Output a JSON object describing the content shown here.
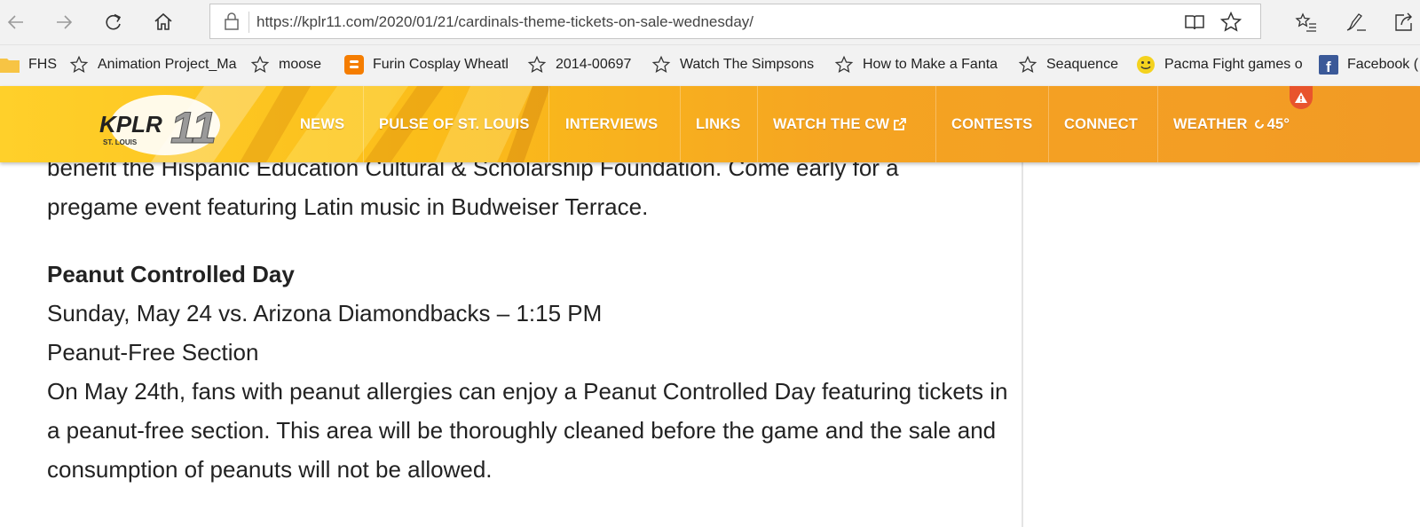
{
  "browser": {
    "url": "https://kplr11.com/2020/01/21/cardinals-theme-tickets-on-sale-wednesday/",
    "icons": [
      "back-icon",
      "forward-icon",
      "refresh-icon",
      "home-icon",
      "lock-icon",
      "reading-view-icon",
      "favorite-star-icon",
      "favorites-hub-icon",
      "notes-pen-icon",
      "share-icon"
    ]
  },
  "bookmarks": [
    {
      "label": "FHS",
      "icon": "folder-icon"
    },
    {
      "label": "Animation Project_Ma",
      "icon": "star-icon"
    },
    {
      "label": "moose",
      "icon": "star-icon"
    },
    {
      "label": "Furin Cosplay Wheatl",
      "icon": "blogger-icon"
    },
    {
      "label": "2014-00697",
      "icon": "star-icon"
    },
    {
      "label": "Watch The Simpsons",
      "icon": "star-icon"
    },
    {
      "label": "How to Make a Fanta",
      "icon": "star-icon"
    },
    {
      "label": "Seaquence",
      "icon": "star-icon"
    },
    {
      "label": "Pacma Fight games o",
      "icon": "smiley-icon"
    },
    {
      "label": "Facebook (",
      "icon": "facebook-icon"
    }
  ],
  "site": {
    "logo_text": "KPLR",
    "logo_number": "11",
    "logo_sub": "ST. LOUIS",
    "nav": [
      "NEWS",
      "PULSE OF ST. LOUIS",
      "INTERVIEWS",
      "LINKS",
      "WATCH THE CW",
      "CONTESTS",
      "CONNECT"
    ],
    "weather_label": "WEATHER",
    "weather_temp": "45°",
    "colors": {
      "header_start": "#ffd02a",
      "header_end": "#f29a25",
      "alert": "#e8542c"
    }
  },
  "article": {
    "cut_line": "benefit the Hispanic Education Cultural & Scholarship Foundation. Come early for a",
    "para1_end": "pregame event featuring Latin music in Budweiser Terrace.",
    "heading": "Peanut Controlled Day",
    "date_line": "Sunday, May 24 vs. Arizona Diamondbacks – 1:15 PM",
    "section": "Peanut-Free Section",
    "body": "On May 24th, fans with peanut allergies can enjoy a Peanut Controlled Day featuring tickets in a peanut-free section. This area will be thoroughly cleaned before the game and the sale and consumption of peanuts will not be allowed."
  }
}
